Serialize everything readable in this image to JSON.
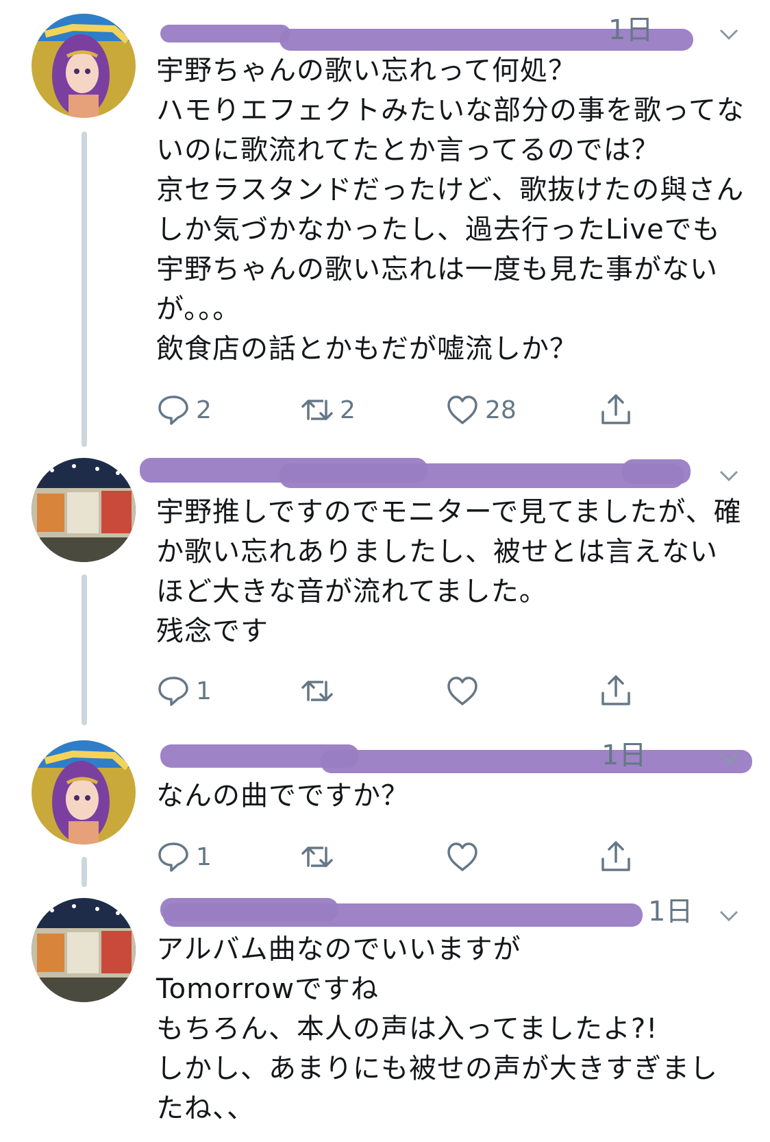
{
  "tweets": [
    {
      "time": "1日",
      "text": "宇野ちゃんの歌い忘れって何処？\nハモりエフェクトみたいな部分の事を歌ってないのに歌流れてたとか言ってるのでは？\n京セラスタンドだったけど、歌抜けたの與さんしか気づかなかったし、過去行ったLiveでも宇野ちゃんの歌い忘れは一度も見た事がないが。。。\n飲食店の話とかもだが嘘流しか？",
      "reply_count": "2",
      "retweet_count": "2",
      "like_count": "28"
    },
    {
      "time": "",
      "text": "宇野推しですのでモニターで見てましたが、確か歌い忘れありましたし、被せとは言えないほど大きな音が流れてました。\n残念です",
      "reply_count": "1",
      "retweet_count": "",
      "like_count": ""
    },
    {
      "time": "1日",
      "text": "なんの曲でですか？",
      "reply_count": "1",
      "retweet_count": "",
      "like_count": ""
    },
    {
      "time": "1日",
      "text": "アルバム曲なのでいいますが\nTomorrowですね\nもちろん、本人の声は入ってましたよ?!\nしかし、あまりにも被せの声が大きすぎましたね、、",
      "reply_count": "",
      "retweet_count": "",
      "like_count": ""
    }
  ],
  "icons": {
    "reply": "reply-bubble-icon",
    "retweet": "retweet-icon",
    "like": "heart-icon",
    "share": "share-icon",
    "more": "chevron-down-icon"
  },
  "colors": {
    "text": "#14171a",
    "muted": "#657786",
    "thread": "#ccd6dd",
    "redaction": "#9a7ec4"
  }
}
